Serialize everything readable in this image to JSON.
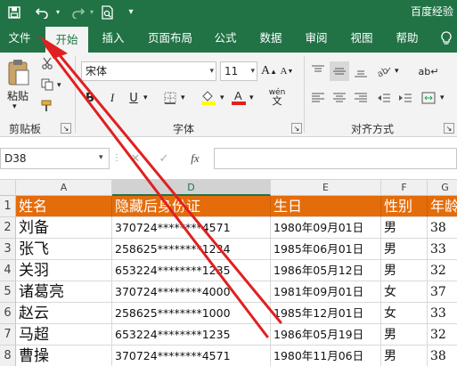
{
  "app_title": "百度经验",
  "tabs": [
    {
      "label": "文件"
    },
    {
      "label": "开始"
    },
    {
      "label": "插入"
    },
    {
      "label": "页面布局"
    },
    {
      "label": "公式"
    },
    {
      "label": "数据"
    },
    {
      "label": "审阅"
    },
    {
      "label": "视图"
    },
    {
      "label": "帮助"
    }
  ],
  "active_tab": "开始",
  "clipboard": {
    "paste_label": "粘贴",
    "group_label": "剪贴板"
  },
  "font": {
    "name": "宋体",
    "size": "11",
    "group_label": "字体",
    "bold": "B",
    "italic": "I",
    "underline": "U",
    "phonetic": "wén",
    "grow": "A",
    "shrink": "A"
  },
  "alignment": {
    "group_label": "对齐方式"
  },
  "formula_bar": {
    "name_box": "D38",
    "fx_label": "fx",
    "cancel": "✕",
    "confirm": "✓",
    "value": ""
  },
  "sheet": {
    "columns": [
      "A",
      "D",
      "E",
      "F",
      "G"
    ],
    "selected_column": "D",
    "row_numbers": [
      "1",
      "2",
      "3",
      "4",
      "5",
      "6",
      "7",
      "8"
    ],
    "header": [
      "姓名",
      "隐藏后身份证",
      "生日",
      "性别",
      "年龄"
    ],
    "rows": [
      [
        "刘备",
        "370724********4571",
        "1980年09月01日",
        "男",
        "38"
      ],
      [
        "张飞",
        "258625********1234",
        "1985年06月01日",
        "男",
        "33"
      ],
      [
        "关羽",
        "653224********1235",
        "1986年05月12日",
        "男",
        "32"
      ],
      [
        "诸葛亮",
        "370724********4000",
        "1981年09月01日",
        "女",
        "37"
      ],
      [
        "赵云",
        "258625********1000",
        "1985年12月01日",
        "女",
        "33"
      ],
      [
        "马超",
        "653224********1235",
        "1986年05月19日",
        "男",
        "32"
      ],
      [
        "曹操",
        "370724********4571",
        "1980年11月06日",
        "男",
        "38"
      ]
    ]
  },
  "colors": {
    "brand": "#217346",
    "header_fill": "#e46c0a",
    "annotation_arrow": "#e02020"
  }
}
